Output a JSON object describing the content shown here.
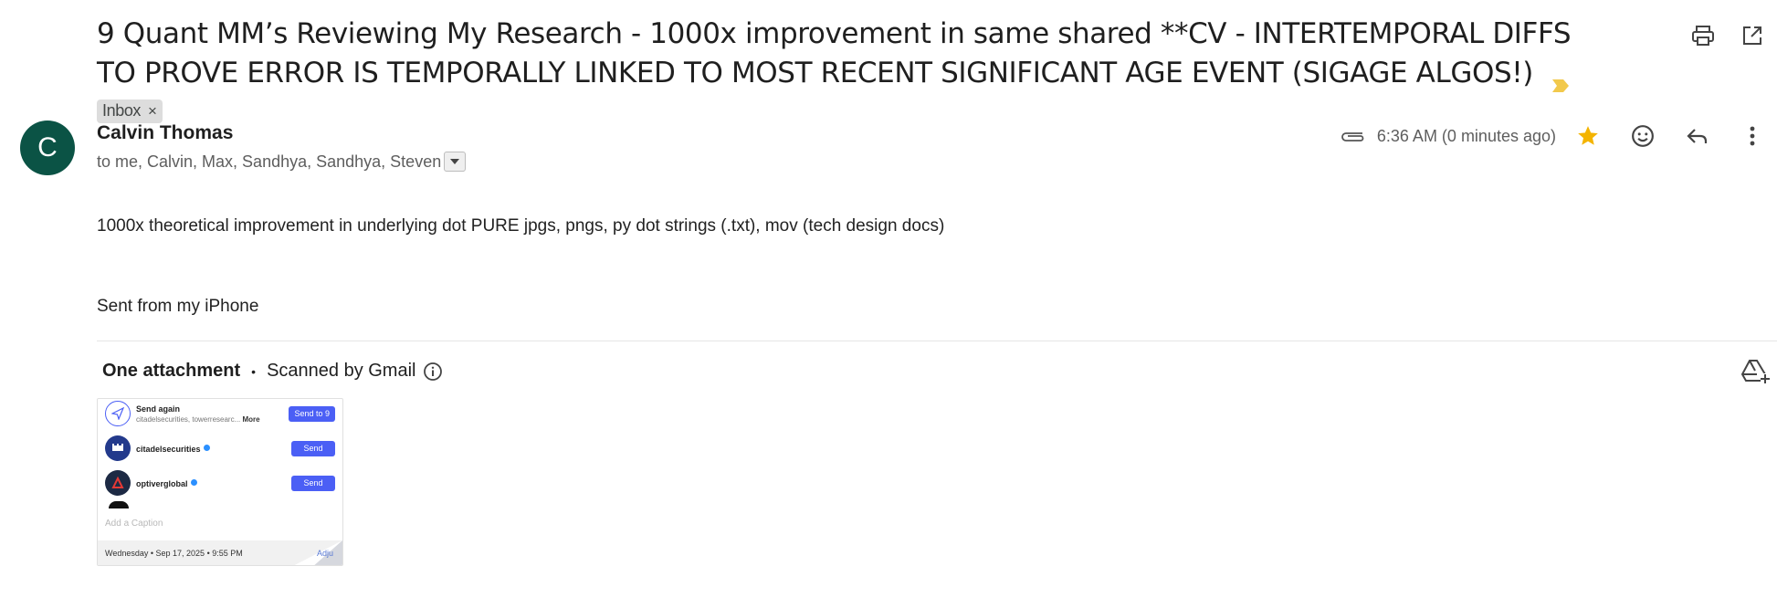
{
  "subject": {
    "text": "9 Quant MM’s Reviewing My Research - 1000x improvement in same shared **CV - INTERTEMPORAL DIFFS TO PROVE ERROR IS TEMPORALLY LINKED TO MOST RECENT SIGNIFICANT AGE EVENT (SIGAGE ALGOS!)",
    "label": "Inbox",
    "label_remove": "×",
    "importance_color": "#f2c94c"
  },
  "top_actions": {
    "print_icon": "print-icon",
    "open_new_window_icon": "open-in-new-icon"
  },
  "message": {
    "avatar_letter": "C",
    "avatar_color": "#0b5345",
    "sender_name": "Calvin Thomas",
    "recipients": "to me, Calvin, Max, Sandhya, Sandhya, Steven",
    "timestamp": "6:36 AM (0 minutes ago)",
    "star_color": "#f4b400",
    "body_line1": "1000x theoretical improvement in underlying dot PURE jpgs, pngs, py dot strings (.txt), mov (tech design docs)",
    "body_line2": "Sent from my iPhone"
  },
  "attachments": {
    "count_label": "One attachment",
    "separator": "•",
    "scanned_label": "Scanned by Gmail",
    "thumbnail": {
      "row1_title": "Send again",
      "row1_sub": "citadelsecurities, towerresearc...",
      "row1_more": "More",
      "row1_button": "Send to 9",
      "row2_title": "citadelsecurities",
      "row2_button": "Send",
      "row3_title": "optiverglobal",
      "row3_button": "Send",
      "caption_placeholder": "Add a Caption",
      "date": "Wednesday • Sep 17, 2025 • 9:55 PM",
      "fold_text": "Adju",
      "accent": "#4b5ff5"
    }
  }
}
